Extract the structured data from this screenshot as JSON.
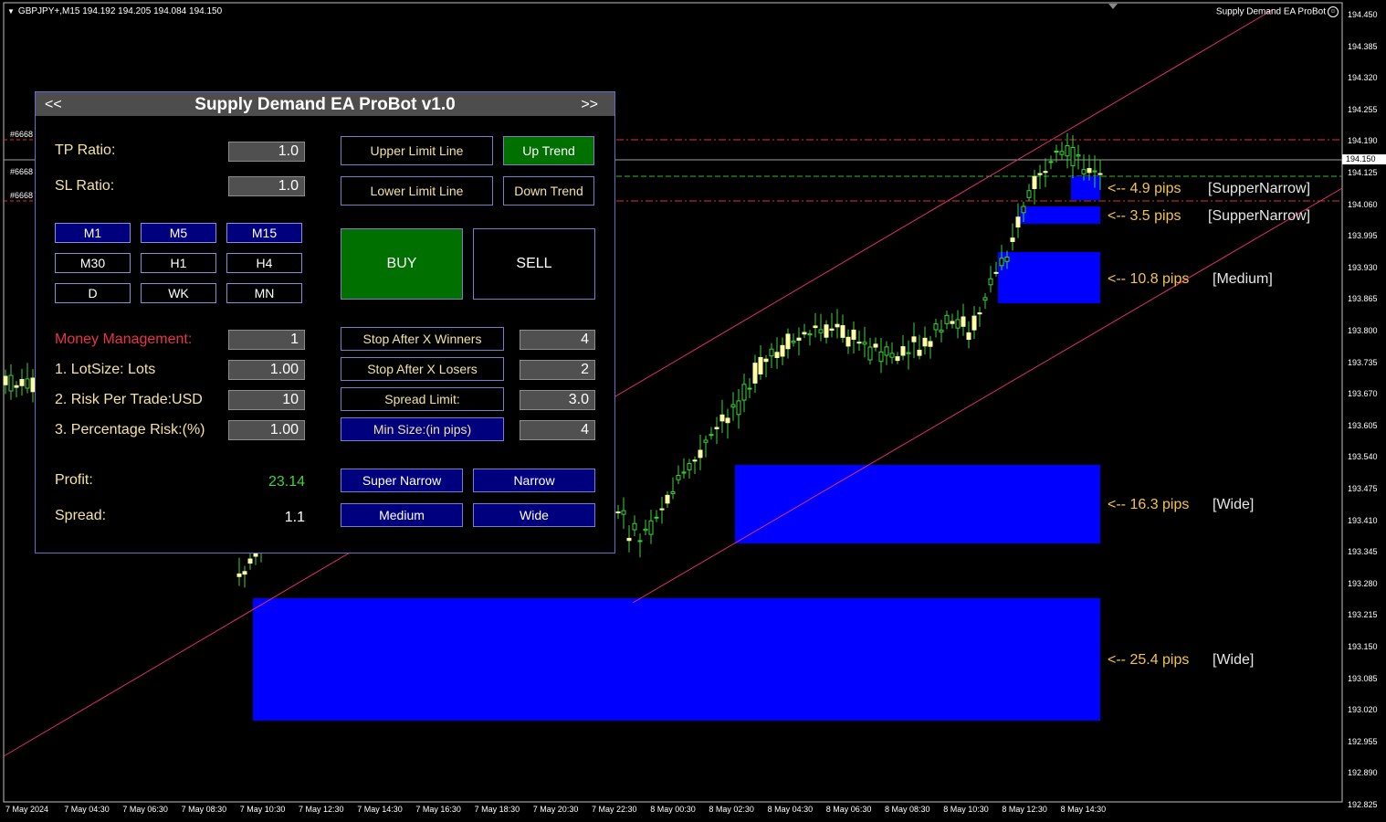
{
  "chart": {
    "symbol_header": "GBPJPY+,M15  194.192 194.205 194.084 194.150",
    "ea_name": "Supply Demand EA ProBot",
    "order_tag": "#6668",
    "current_price": "194.150",
    "price_ticks": [
      "194.450",
      "194.385",
      "194.320",
      "194.255",
      "194.190",
      "194.125",
      "194.060",
      "193.995",
      "193.930",
      "193.865",
      "193.800",
      "193.735",
      "193.670",
      "193.605",
      "193.540",
      "193.475",
      "193.410",
      "193.345",
      "193.280",
      "193.215",
      "193.150",
      "193.085",
      "193.020",
      "192.955",
      "192.890",
      "192.825"
    ],
    "time_ticks": [
      "7 May 2024",
      "7 May 04:30",
      "7 May 06:30",
      "7 May 08:30",
      "7 May 10:30",
      "7 May 12:30",
      "7 May 14:30",
      "7 May 16:30",
      "7 May 18:30",
      "7 May 20:30",
      "7 May 22:30",
      "8 May 00:30",
      "8 May 02:30",
      "8 May 04:30",
      "8 May 06:30",
      "8 May 08:30",
      "8 May 10:30",
      "8 May 12:30",
      "8 May 14:30"
    ],
    "colors": {
      "background": "#000000",
      "zone": "#0000ff",
      "bull": "#ffffa8",
      "wick": "#39d339",
      "channel": "#e0306a"
    }
  },
  "zones": [
    {
      "pips_label": "<-- 4.9 pips",
      "type_label": "[SupperNarrow]"
    },
    {
      "pips_label": "<-- 3.5 pips",
      "type_label": "[SupperNarrow]"
    },
    {
      "pips_label": "<-- 10.8 pips",
      "type_label": "[Medium]"
    },
    {
      "pips_label": "<-- 16.3 pips",
      "type_label": "[Wide]"
    },
    {
      "pips_label": "<-- 25.4 pips",
      "type_label": "[Wide]"
    }
  ],
  "panel": {
    "title": "Supply Demand EA ProBot v1.0",
    "nav_prev": "<<",
    "nav_next": ">>",
    "tp_ratio": {
      "label": "TP Ratio:",
      "value": "1.0"
    },
    "sl_ratio": {
      "label": "SL Ratio:",
      "value": "1.0"
    },
    "timeframes": [
      "M1",
      "M5",
      "M15",
      "M30",
      "H1",
      "H4",
      "D",
      "WK",
      "MN"
    ],
    "upper_limit_line": "Upper Limit Line",
    "lower_limit_line": "Lower Limit Line",
    "up_trend": "Up Trend",
    "down_trend": "Down Trend",
    "buy": "BUY",
    "sell": "SELL",
    "money_management": {
      "label": "Money Management:",
      "value": "1"
    },
    "lot_size": {
      "label": "1. LotSize: Lots",
      "value": "1.00"
    },
    "risk_per_trade": {
      "label": "2. Risk Per Trade:USD",
      "value": "10"
    },
    "percentage_risk": {
      "label": "3. Percentage Risk:(%)",
      "value": "1.00"
    },
    "stop_after_winners": {
      "label": "Stop After X Winners",
      "value": "4"
    },
    "stop_after_losers": {
      "label": "Stop After X Losers",
      "value": "2"
    },
    "spread_limit": {
      "label": "Spread Limit:",
      "value": "3.0"
    },
    "min_size": {
      "label": "Min Size:(in pips)",
      "value": "4"
    },
    "profit": {
      "label": "Profit:",
      "value": "23.14"
    },
    "spread": {
      "label": "Spread:",
      "value": "1.1"
    },
    "zone_buttons": [
      "Super Narrow",
      "Narrow",
      "Medium",
      "Wide"
    ]
  }
}
